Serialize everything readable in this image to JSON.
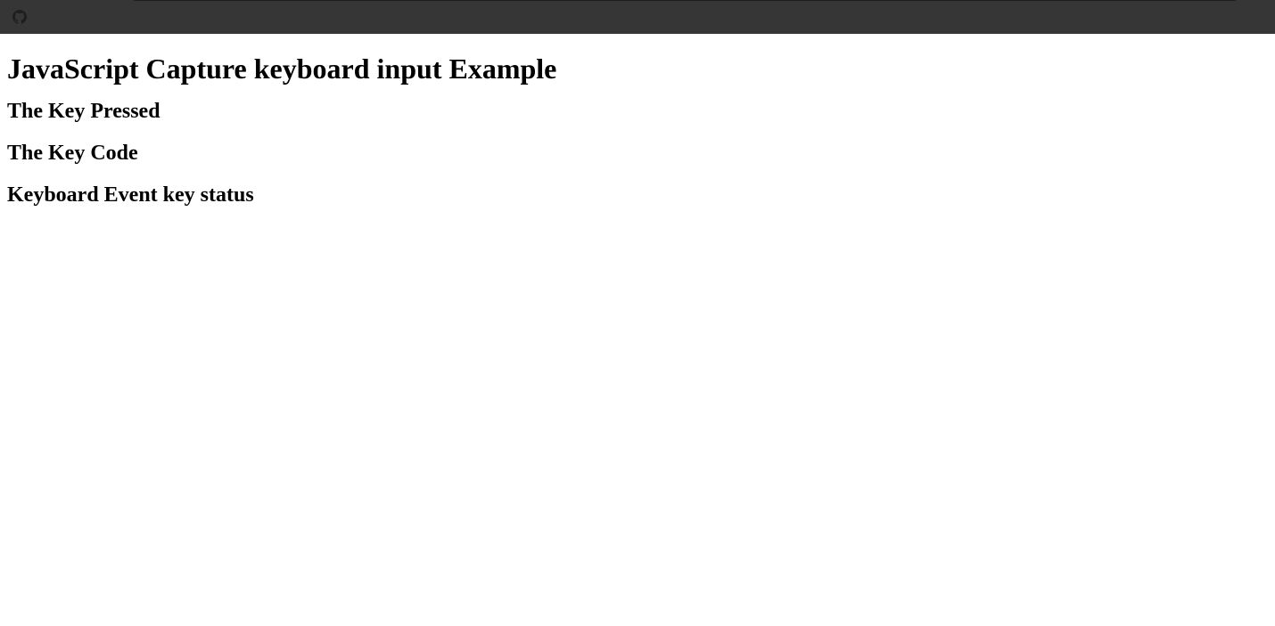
{
  "header": {
    "icon": "github-icon"
  },
  "main": {
    "title": "JavaScript Capture keyboard input Example",
    "sections": [
      {
        "label": "The Key Pressed"
      },
      {
        "label": "The Key Code"
      },
      {
        "label": "Keyboard Event key status"
      }
    ]
  },
  "colors": {
    "topbar": "#363636",
    "icon": "#1e1e1e",
    "text": "#000000",
    "background": "#ffffff"
  }
}
